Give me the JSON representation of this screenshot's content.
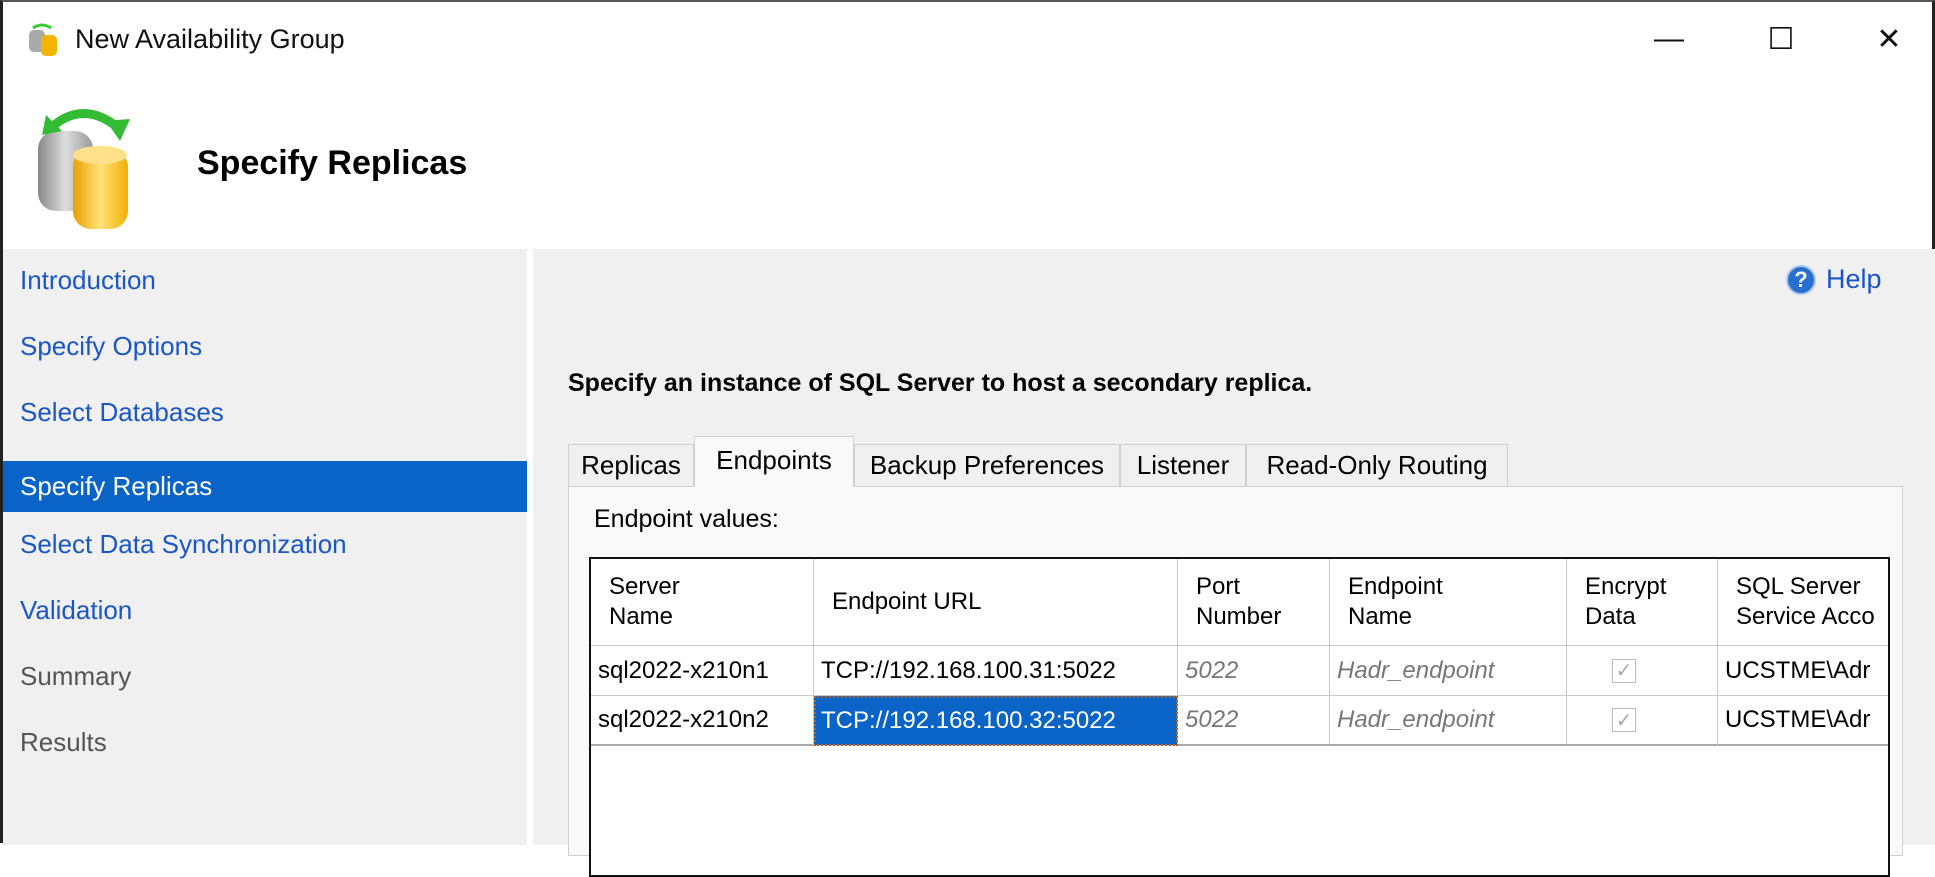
{
  "window": {
    "title": "New Availability Group",
    "minimize": "—",
    "maximize": "☐",
    "close": "✕"
  },
  "header": {
    "title": "Specify Replicas"
  },
  "nav": {
    "items": [
      {
        "label": "Introduction",
        "state": "link"
      },
      {
        "label": "Specify Options",
        "state": "link"
      },
      {
        "label": "Select Databases",
        "state": "link"
      },
      {
        "label": "Specify Replicas",
        "state": "selected"
      },
      {
        "label": "Select Data Synchronization",
        "state": "link"
      },
      {
        "label": "Validation",
        "state": "link"
      },
      {
        "label": "Summary",
        "state": "disabled"
      },
      {
        "label": "Results",
        "state": "disabled"
      }
    ]
  },
  "help": {
    "label": "Help",
    "icon": "?"
  },
  "instruction": "Specify an instance of SQL Server to host a secondary replica.",
  "tabs": [
    "Replicas",
    "Endpoints",
    "Backup Preferences",
    "Listener",
    "Read-Only Routing"
  ],
  "active_tab": "Endpoints",
  "panel": {
    "label": "Endpoint values:"
  },
  "grid": {
    "columns": [
      [
        "Server",
        "Name"
      ],
      [
        "Endpoint URL"
      ],
      [
        "Port",
        "Number"
      ],
      [
        "Endpoint",
        "Name"
      ],
      [
        "Encrypt",
        "Data"
      ],
      [
        "SQL Server",
        "Service Acco"
      ]
    ],
    "rows": [
      {
        "server": "sql2022-x210n1",
        "url": "TCP://192.168.100.31:5022",
        "port": "5022",
        "endpoint": "Hadr_endpoint",
        "encrypt": true,
        "account": "UCSTME\\Adr"
      },
      {
        "server": "sql2022-x210n2",
        "url": "TCP://192.168.100.32:5022",
        "port": "5022",
        "endpoint": "Hadr_endpoint",
        "encrypt": true,
        "account": "UCSTME\\Adr"
      }
    ]
  },
  "colors": {
    "accent": "#0a64c8",
    "link": "#1a56c8",
    "panel_bg": "#f0f0f0"
  }
}
